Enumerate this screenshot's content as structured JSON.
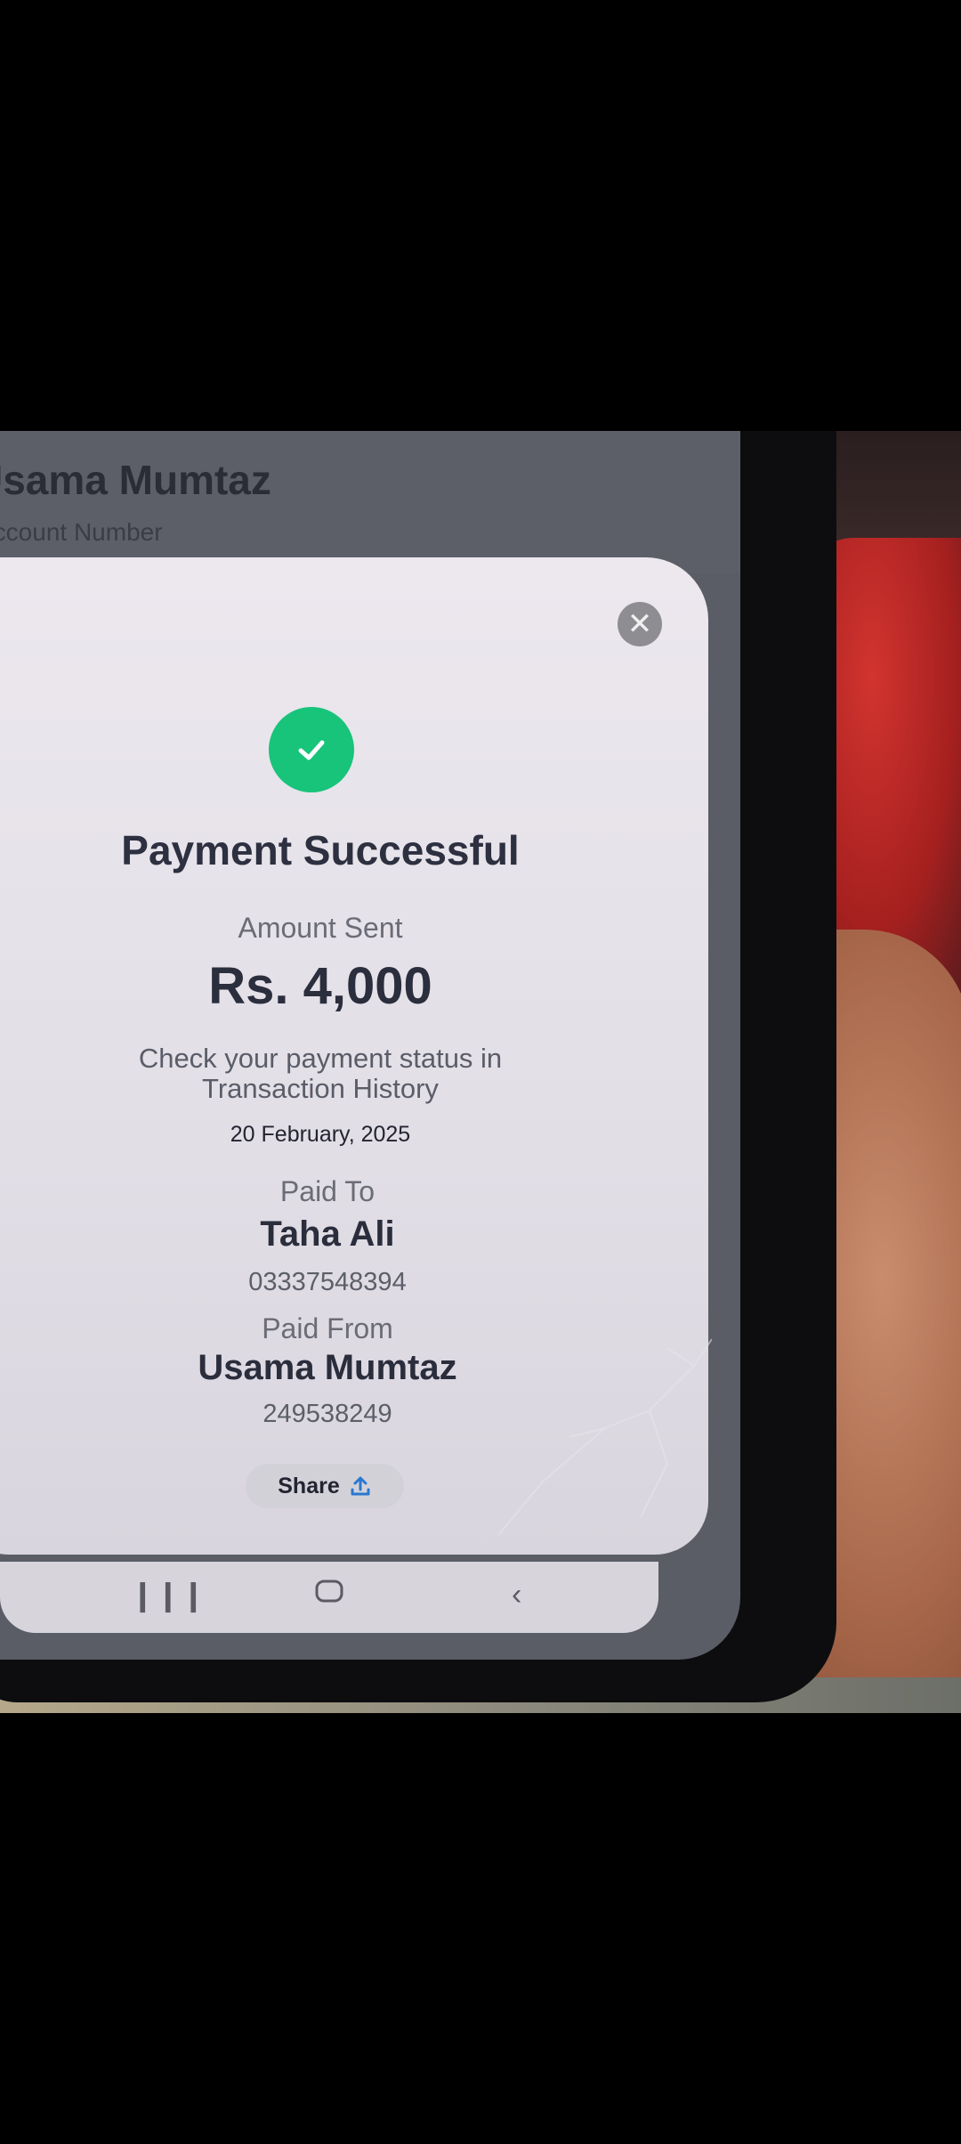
{
  "background_screen": {
    "account_name": "Usama Mumtaz",
    "account_label": "Account Number"
  },
  "receipt": {
    "title": "Payment Successful",
    "amount_label": "Amount Sent",
    "amount": "Rs. 4,000",
    "status_line1": "Check your payment status in",
    "status_line2": "Transaction History",
    "date": "20 February, 2025",
    "paid_to_label": "Paid To",
    "paid_to_name": "Taha Ali",
    "paid_to_number": "03337548394",
    "paid_from_label": "Paid From",
    "paid_from_name": "Usama Mumtaz",
    "paid_from_number": "249538249",
    "share_label": "Share"
  },
  "icons": {
    "close": "close-icon",
    "success": "checkmark-icon",
    "share": "share-upload-icon",
    "nav_recents": "recents-icon",
    "nav_home": "home-icon",
    "nav_back": "back-icon"
  },
  "colors": {
    "success_green": "#17c47a",
    "share_icon_blue": "#2a78d0",
    "sheet_bg": "#ece8ee"
  }
}
